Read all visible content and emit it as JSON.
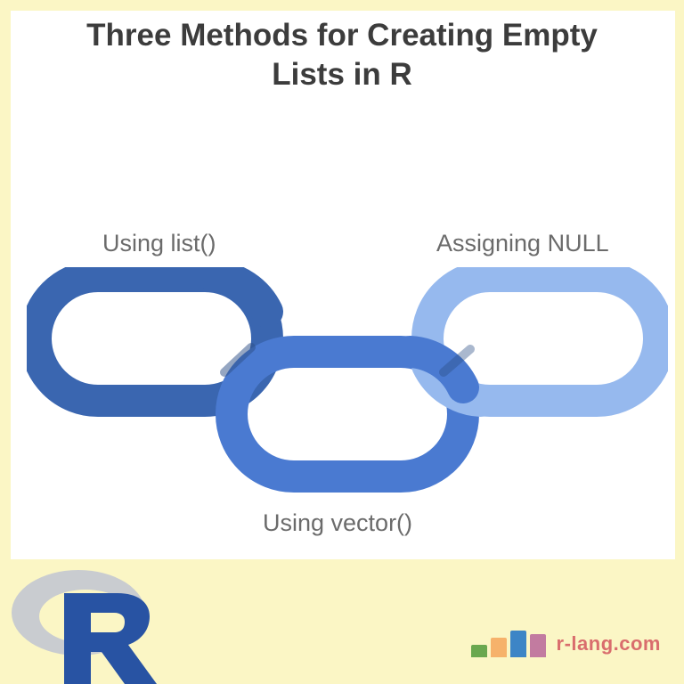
{
  "title": "Three Methods for Creating Empty Lists in R",
  "methods": {
    "left": "Using list()",
    "right": "Assigning NULL",
    "bottom": "Using vector()"
  },
  "brand": {
    "text": "r-lang.com"
  },
  "colors": {
    "link_left": "#3a66b0",
    "link_center": "#4a7ad1",
    "link_right": "#96b9ee",
    "shadow": "#2b4d85"
  }
}
